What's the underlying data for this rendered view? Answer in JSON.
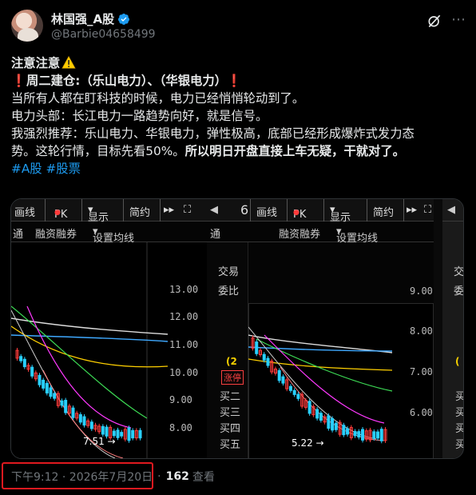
{
  "author": {
    "name": "林国强_A股",
    "handle": "@Barbie04658499"
  },
  "tweet": {
    "line1": "注意注意",
    "line2_prefix": "周二建仓:（乐山电力）、（华银电力）",
    "line3": "当所有人都在盯科技的时候，电力已经悄悄轮动到了。",
    "line4": "电力头部：长江电力一路趋势向好，就是信号。",
    "line5": "我强烈推荐：乐山电力、华银电力，弹性极高，底部已经形成爆炸式发力态",
    "line6_normal": "势。这轮行情，目标先看50%。",
    "line6_bold": "所以明日开盘直接上车无疑，干就对了。",
    "hashtags": [
      "#A股",
      "#股票"
    ]
  },
  "charts": {
    "toolbar": {
      "tab_draw": "画线",
      "tab_pk": "PK",
      "tab_display": "显示",
      "tab_simple": "简约",
      "tab_more": "▸▸",
      "sub_tong": "通",
      "sub_margin": "融资融券",
      "sub_ma": "设置均线"
    },
    "panelA": {
      "yticks": [
        "13.00",
        "12.00",
        "11.00",
        "10.00",
        "9.00",
        "8.00"
      ],
      "low_label": "7.51"
    },
    "panelB": {
      "side_trade": "交易",
      "side_ratio": "委比",
      "side_code": "(2",
      "side_rise": "涨停",
      "side_buy": [
        "买二",
        "买三",
        "买四",
        "买五"
      ],
      "first_letter": "6",
      "yticks": [
        "9.00",
        "8.00",
        "7.00",
        "6.00"
      ],
      "low_label": "5.22"
    },
    "panelC": {
      "side_trade": "交易",
      "side_ratio": "委比",
      "side_paren": "(",
      "side_buy": [
        "买",
        "买",
        "买",
        "买"
      ]
    }
  },
  "footer": {
    "time": "下午9:12 · 2026年7月20日",
    "dot": "·",
    "views": "162",
    "views_label": "查看"
  },
  "colors": {
    "accent": "#1d9bf0",
    "alert": "#f4212e",
    "candle_up": "#ff3b3b",
    "candle_down": "#29d0ff",
    "highlight_box": "#e0191f"
  }
}
